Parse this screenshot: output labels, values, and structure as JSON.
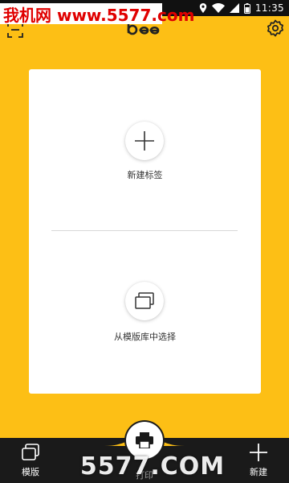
{
  "status_bar": {
    "time": "11:35",
    "icons": [
      "location-icon",
      "wifi-icon",
      "signal-icon",
      "battery-icon"
    ]
  },
  "watermark_top": "我机网 www.5577.com",
  "header": {
    "logo_text": "bee",
    "icons": [
      "scan-icon",
      "settings-icon"
    ]
  },
  "card": {
    "new_label_text": "新建标签",
    "template_text": "从模版库中选择"
  },
  "bottom_nav": {
    "templates_label": "模版",
    "new_label": "新建",
    "print_label": "打印"
  },
  "watermark_bottom": "5577.COM",
  "colors": {
    "background": "#FDBF15",
    "bottom_bar": "#1A1A1A",
    "card": "#FFFFFF"
  }
}
